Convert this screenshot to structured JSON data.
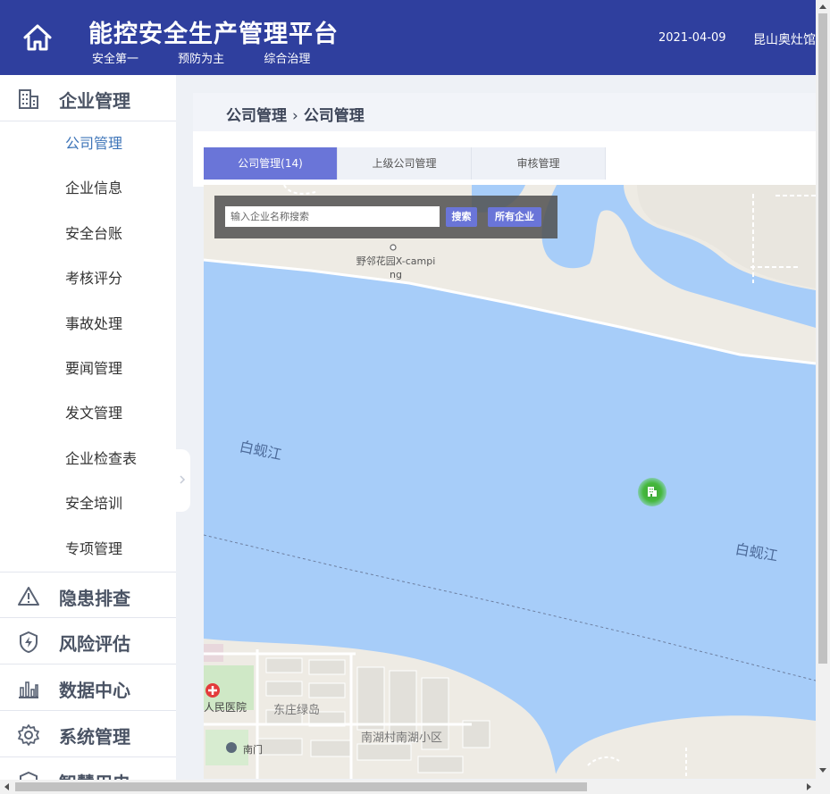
{
  "header": {
    "title": "能控安全生产管理平台",
    "slogans": [
      "安全第一",
      "预防为主",
      "综合治理"
    ],
    "date": "2021-04-09",
    "user": "昆山奥灶馆"
  },
  "sidebar": {
    "sections": [
      {
        "label": "企业管理",
        "icon": "building-icon",
        "items": [
          "公司管理",
          "企业信息",
          "安全台账",
          "考核评分",
          "事故处理",
          "要闻管理",
          "发文管理",
          "企业检查表",
          "安全培训",
          "专项管理"
        ]
      },
      {
        "label": "隐患排查",
        "icon": "warning-icon"
      },
      {
        "label": "风险评估",
        "icon": "shield-bolt-icon"
      },
      {
        "label": "数据中心",
        "icon": "bar-chart-icon"
      },
      {
        "label": "系统管理",
        "icon": "gear-icon"
      },
      {
        "label": "智慧用电",
        "icon": "power-icon"
      }
    ],
    "active_item": "公司管理"
  },
  "breadcrumb": {
    "parent": "公司管理",
    "current": "公司管理"
  },
  "tabs": [
    {
      "label": "公司管理(14)",
      "active": true
    },
    {
      "label": "上级公司管理",
      "active": false
    },
    {
      "label": "审核管理",
      "active": false
    }
  ],
  "search": {
    "placeholder": "输入企业名称搜索",
    "search_label": "搜索",
    "all_label": "所有企业"
  },
  "map": {
    "labels": {
      "river_1": "白蚬江",
      "river_2": "白蚬江",
      "poi": "野邻花园X-camping",
      "hospital": "人民医院",
      "district_1": "东庄绿岛",
      "district_2": "南湖村南湖小区",
      "gate": "南门"
    },
    "colors": {
      "water": "#a7cdf9",
      "land": "#eeebe4",
      "marker": "#46b83e"
    },
    "marker_icon": "building-icon"
  },
  "colors": {
    "header": "#2f3f9e",
    "accent": "#6a75d8",
    "active_menu": "#3d74b8"
  }
}
